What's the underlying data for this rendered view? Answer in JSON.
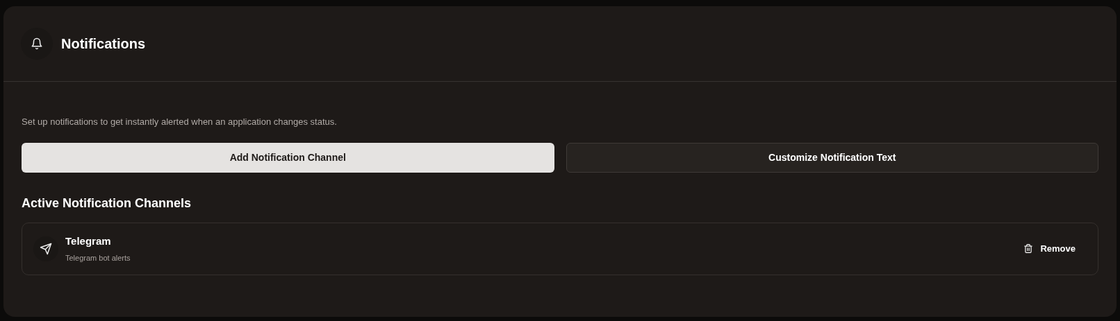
{
  "header": {
    "title": "Notifications"
  },
  "description": "Set up notifications to get instantly alerted when an application changes status.",
  "buttons": [
    {
      "label": "Add Notification Channel",
      "kind": "primary"
    },
    {
      "label": "Customize Notification Text",
      "kind": "outline"
    }
  ],
  "active_channels": {
    "heading": "Active Notification Channels",
    "items": [
      {
        "name": "Telegram",
        "subtitle": "Telegram bot alerts",
        "action": "Remove"
      }
    ]
  }
}
